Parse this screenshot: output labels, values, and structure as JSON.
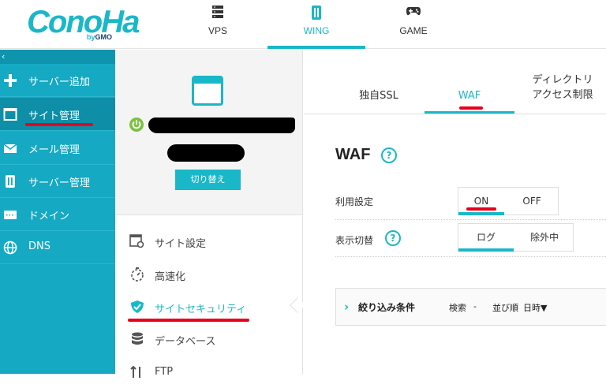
{
  "header": {
    "logo_text": "ConoHa",
    "logo_by": "by",
    "logo_brand": "GMO",
    "tabs": [
      {
        "label": "VPS",
        "icon": "server-icon"
      },
      {
        "label": "WING",
        "icon": "wing-icon"
      },
      {
        "label": "GAME",
        "icon": "gamepad-icon"
      }
    ],
    "active_tab": "WING"
  },
  "sidebar": {
    "collapse_glyph": "‹",
    "items": [
      {
        "label": "サーバー追加",
        "icon": "plus-icon"
      },
      {
        "label": "サイト管理",
        "icon": "site-icon"
      },
      {
        "label": "メール管理",
        "icon": "mail-icon"
      },
      {
        "label": "サーバー管理",
        "icon": "server-manage-icon"
      },
      {
        "label": "ドメイン",
        "icon": "domain-icon"
      },
      {
        "label": "DNS",
        "icon": "globe-icon"
      }
    ],
    "active_item": "サイト管理"
  },
  "site_panel": {
    "switch_label": "切り替え",
    "menu": [
      {
        "label": "サイト設定",
        "icon": "site-settings-icon"
      },
      {
        "label": "高速化",
        "icon": "stopwatch-icon"
      },
      {
        "label": "サイトセキュリティ",
        "icon": "shield-check-icon"
      },
      {
        "label": "データベース",
        "icon": "database-icon"
      },
      {
        "label": "FTP",
        "icon": "transfer-icon"
      }
    ],
    "active_menu": "サイトセキュリティ"
  },
  "content": {
    "tabs": [
      {
        "label": "独自SSL"
      },
      {
        "label": "WAF"
      },
      {
        "label_line1": "ディレクトリ",
        "label_line2": "アクセス制限"
      }
    ],
    "active_tab": "WAF",
    "title": "WAF",
    "help_glyph": "?",
    "usage": {
      "label": "利用設定",
      "on": "ON",
      "off": "OFF",
      "selected": "ON"
    },
    "display": {
      "label": "表示切替",
      "log": "ログ",
      "excluded": "除外中",
      "selected": "ログ"
    },
    "filter": {
      "title": "絞り込み条件",
      "search_label": "検索",
      "search_value": "-",
      "sort_label": "並び順",
      "sort_value": "日時▼"
    }
  },
  "colors": {
    "accent": "#19b8c8",
    "sidebar": "#16a9c3",
    "annotation_red": "#e8001c",
    "power_green": "#7cc242"
  }
}
